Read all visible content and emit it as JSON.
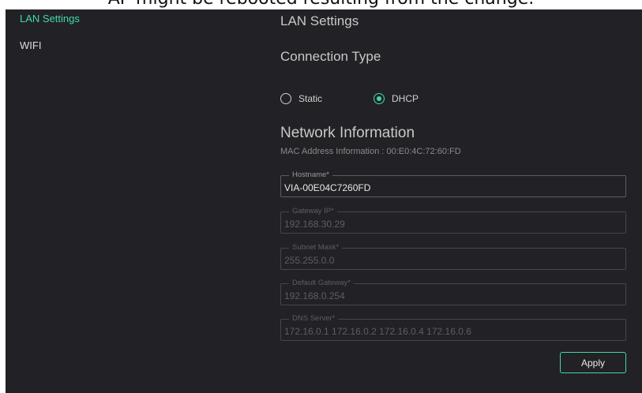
{
  "banner": {
    "text": "AP might be rebooted resulting from the change."
  },
  "sidebar": {
    "items": [
      {
        "label": "LAN Settings",
        "active": true
      },
      {
        "label": "WIFI",
        "active": false
      }
    ]
  },
  "main": {
    "page_title": "LAN Settings",
    "connection_type": {
      "title": "Connection Type",
      "options": [
        {
          "label": "Static",
          "selected": false
        },
        {
          "label": "DHCP",
          "selected": true
        }
      ]
    },
    "network_info": {
      "title": "Network Information",
      "mac_text": "MAC Address Information : 00:E0:4C:72:60:FD",
      "fields": [
        {
          "label": "Hostname*",
          "value": "VIA-00E04C7260FD",
          "enabled": true
        },
        {
          "label": "Gateway IP*",
          "value": "192.168.30.29",
          "enabled": false
        },
        {
          "label": "Subnet Mask*",
          "value": "255.255.0.0",
          "enabled": false
        },
        {
          "label": "Default Gateway*",
          "value": "192.168.0.254",
          "enabled": false
        },
        {
          "label": "DNS Server*",
          "value": "172.16.0.1 172.16.0.2 172.16.0.4 172.16.0.6",
          "enabled": false
        }
      ]
    },
    "apply_label": "Apply"
  },
  "colors": {
    "accent": "#41d8a8",
    "background": "#222226",
    "disabled_text": "#5e5e62"
  }
}
